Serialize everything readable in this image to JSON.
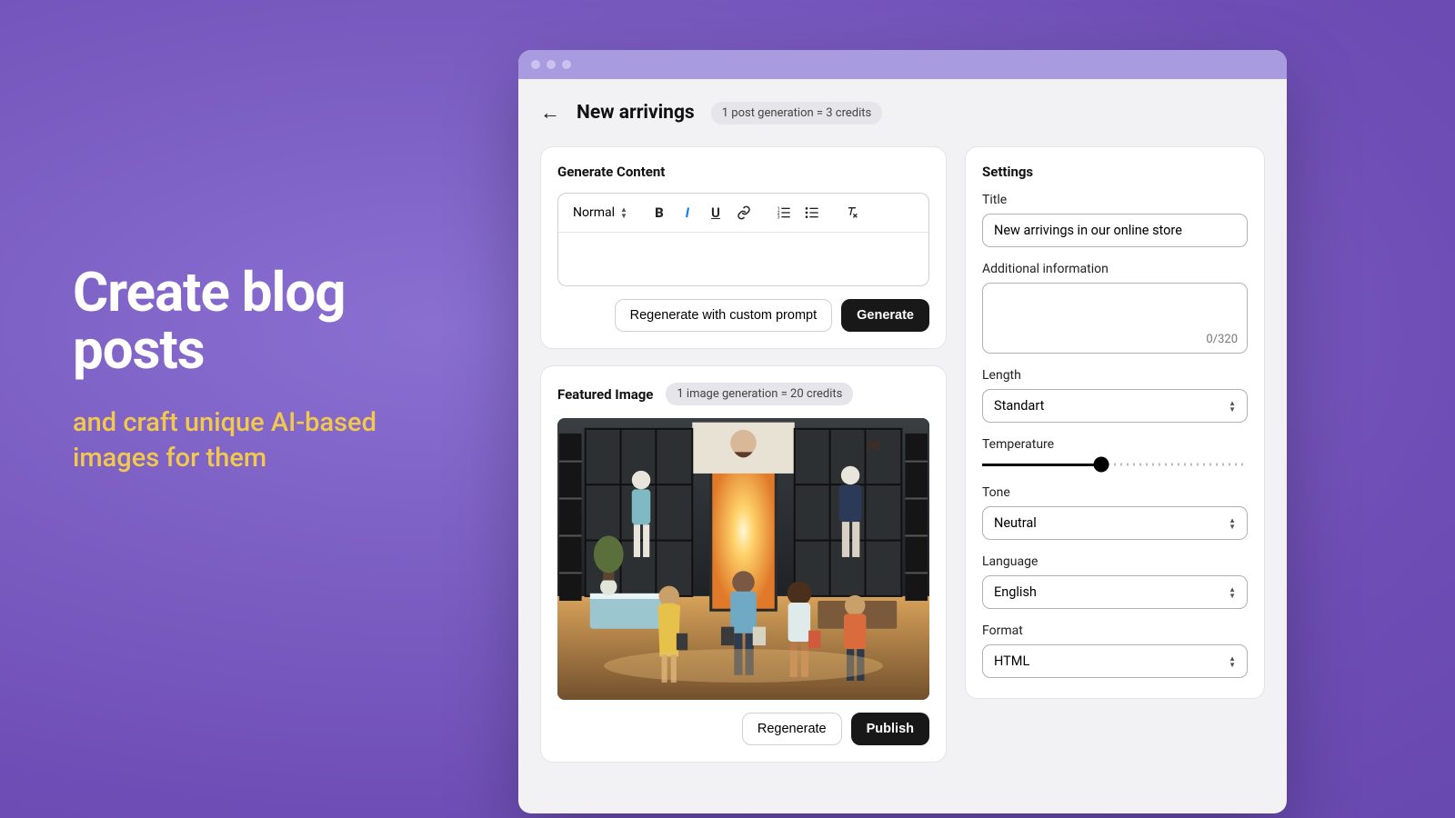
{
  "marketing": {
    "headline": "Create blog posts",
    "subline": "and craft unique AI-based images for them"
  },
  "header": {
    "title": "New arrivings",
    "credit_pill": "1 post generation = 3 credits"
  },
  "content_card": {
    "title": "Generate Content",
    "toolbar": {
      "paragraph": "Normal"
    },
    "regenerate_btn": "Regenerate with custom prompt",
    "generate_btn": "Generate"
  },
  "image_card": {
    "title": "Featured Image",
    "credit_pill": "1 image generation = 20 credits",
    "regenerate_btn": "Regenerate",
    "publish_btn": "Publish"
  },
  "settings": {
    "title": "Settings",
    "fields": {
      "title_label": "Title",
      "title_value": "New arrivings in our online store",
      "addl_label": "Additional information",
      "addl_count": "0/320",
      "length_label": "Length",
      "length_value": "Standart",
      "temp_label": "Temperature",
      "temp_value": 0.45,
      "tone_label": "Tone",
      "tone_value": "Neutral",
      "lang_label": "Language",
      "lang_value": "English",
      "format_label": "Format",
      "format_value": "HTML"
    }
  }
}
